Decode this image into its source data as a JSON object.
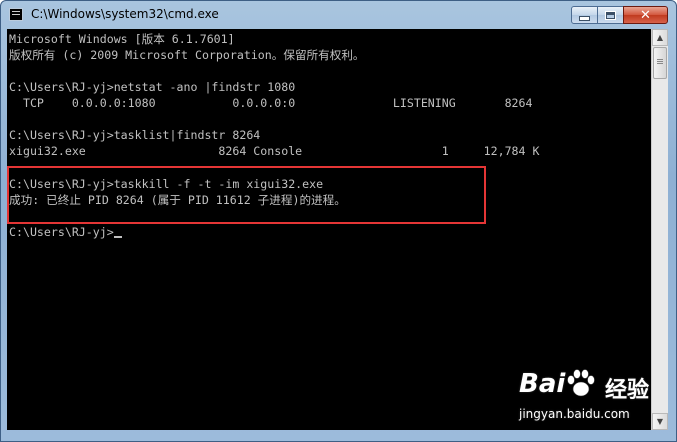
{
  "window": {
    "title": "C:\\Windows\\system32\\cmd.exe",
    "minimize_label": "",
    "maximize_label": "",
    "close_label": "✕"
  },
  "console": {
    "lines": [
      "Microsoft Windows [版本 6.1.7601]",
      "版权所有 (c) 2009 Microsoft Corporation。保留所有权利。",
      "",
      "C:\\Users\\RJ-yj>netstat -ano |findstr 1080",
      "  TCP    0.0.0.0:1080           0.0.0.0:0              LISTENING       8264",
      "",
      "C:\\Users\\RJ-yj>tasklist|findstr 8264",
      "xigui32.exe                   8264 Console                    1     12,784 K",
      "",
      "C:\\Users\\RJ-yj>taskkill -f -t -im xigui32.exe",
      "成功: 已终止 PID 8264 (属于 PID 11612 子进程)的进程。",
      "",
      "C:\\Users\\RJ-yj>"
    ]
  },
  "watermark": {
    "brand": "Bai",
    "product": "经验",
    "url": "jingyan.baidu.com"
  },
  "colors": {
    "console_bg": "#000000",
    "console_text": "#c0c0c0",
    "highlight": "#e43535"
  }
}
